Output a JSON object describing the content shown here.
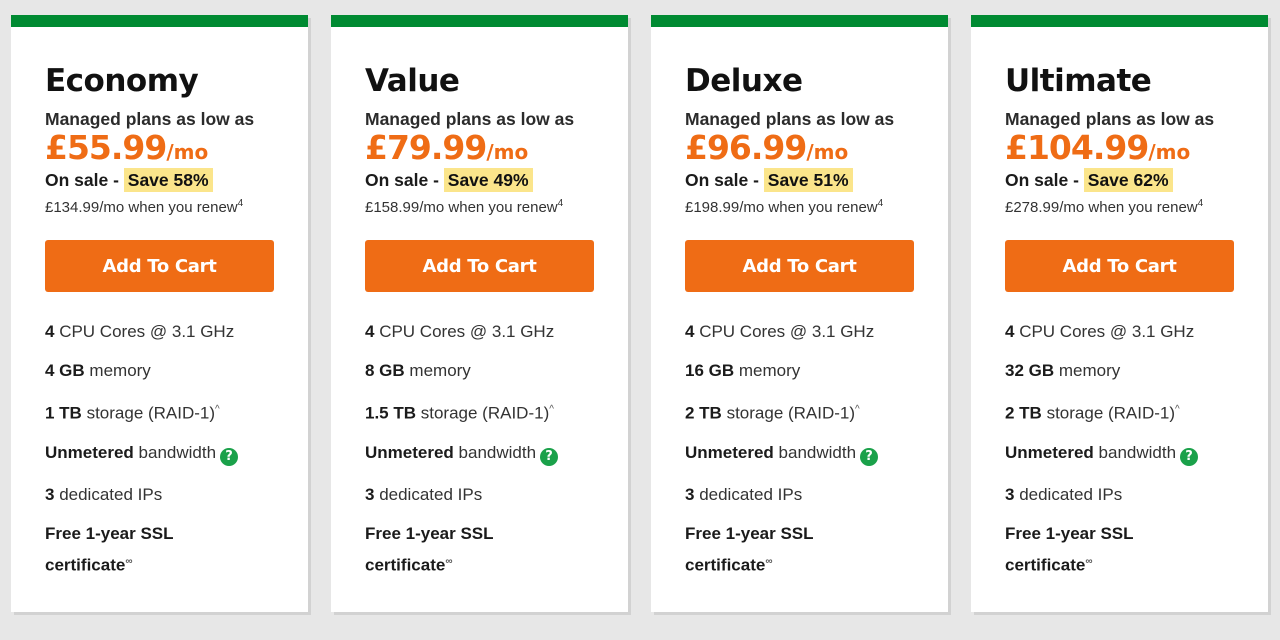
{
  "colors": {
    "brand_green": "#008a32",
    "accent_orange": "#ef6c15",
    "save_highlight": "#fbe58b",
    "help_icon_green": "#1aa14a"
  },
  "common": {
    "managed_label": "Managed plans as low as",
    "per_month": "/mo",
    "on_sale_prefix": "On sale - ",
    "renew_suffix": "/mo when you renew",
    "renew_footnote": "4",
    "add_to_cart_label": "Add To Cart",
    "cpu_bold": "4",
    "cpu_text": " CPU Cores @ 3.1 GHz",
    "memory_text": " memory",
    "storage_text": " storage (RAID-1)",
    "storage_footnote": "^",
    "bandwidth_bold": "Unmetered",
    "bandwidth_text": " bandwidth",
    "help_icon": "question-circle-icon",
    "help_glyph": "?",
    "ips_bold": "3",
    "ips_text": " dedicated IPs",
    "ssl_text": "Free 1-year SSL certificate",
    "ssl_footnote": "∞"
  },
  "plans": [
    {
      "name": "Economy",
      "price": "£55.99",
      "save": "Save 58%",
      "renew_price": "£134.99",
      "memory": "4 GB",
      "storage": "1 TB"
    },
    {
      "name": "Value",
      "price": "£79.99",
      "save": "Save 49%",
      "renew_price": "£158.99",
      "memory": "8 GB",
      "storage": "1.5 TB"
    },
    {
      "name": "Deluxe",
      "price": "£96.99",
      "save": "Save 51%",
      "renew_price": "£198.99",
      "memory": "16 GB",
      "storage": "2 TB"
    },
    {
      "name": "Ultimate",
      "price": "£104.99",
      "save": "Save 62%",
      "renew_price": "£278.99",
      "memory": "32 GB",
      "storage": "2 TB"
    }
  ]
}
